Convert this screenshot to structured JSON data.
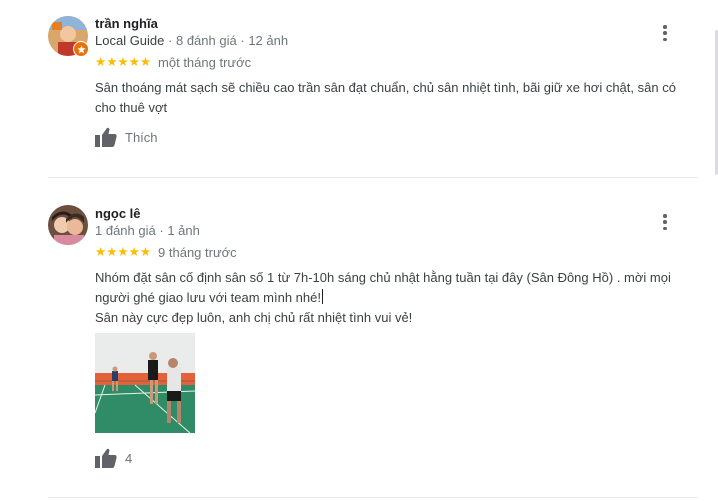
{
  "reviews": [
    {
      "author": "trần nghĩa",
      "guide_label": "Local Guide",
      "separator": "·",
      "review_count": "8 đánh giá",
      "photo_count": "12 ảnh",
      "rating": 5,
      "stars": "★★★★★",
      "time": "một tháng trước",
      "text": "Sân thoáng mát sạch sẽ chiều cao trần sân đạt chuẩn, chủ sân nhiệt tình, bãi giữ xe hơi chật, sân có cho thuê vợt",
      "like_label": "Thích"
    },
    {
      "author": "ngọc lê",
      "separator": "·",
      "review_count": "1 đánh giá",
      "photo_count": "1 ảnh",
      "rating": 5,
      "stars": "★★★★★",
      "time": "9 tháng trước",
      "text_line1": "Nhóm đặt sân cố định sân số 1 từ 7h-10h sáng chủ nhật hằng tuần tại đây (Sân Đông Hồ) . mời mọi người ghé giao lưu với team mình nhé!",
      "text_line2": "Sân này cực đẹp luôn, anh chị chủ rất nhiệt tình vui vẻ!",
      "like_count": "4"
    }
  ],
  "colors": {
    "star": "#fbbc04",
    "meta_text": "#70757a",
    "body_text": "#3c4043",
    "divider": "#e8eaed"
  },
  "icons": {
    "like": "thumb-up-icon",
    "more": "more-vert-icon",
    "local_guide_badge": "local-guide-star-icon"
  }
}
